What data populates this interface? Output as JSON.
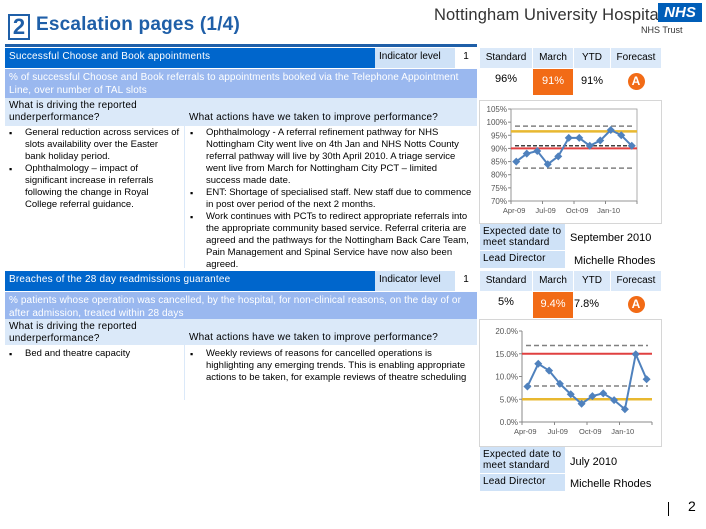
{
  "header": {
    "page_number_box": "2",
    "title": "Escalation pages (1/4)",
    "org_name": "Nottingham University Hospitals",
    "nhs_logo": "NHS",
    "trust_label": "NHS Trust"
  },
  "kpi_headers": {
    "standard": "Standard",
    "month": "March",
    "ytd": "YTD",
    "forecast": "Forecast"
  },
  "indicators": [
    {
      "name": "Successful Choose and Book appointments",
      "indicator_level_label": "Indicator level",
      "indicator_level": "1",
      "description": "% of successful Choose and Book referrals to appointments booked via the Telephone Appointment Line, over number of TAL slots",
      "standard": "96%",
      "month_value": "91%",
      "ytd": "91%",
      "forecast": "A",
      "driving_heading": "What is driving the reported underperformance?",
      "driving_items": [
        "General reduction across services of slots availability over the Easter bank holiday period.",
        "Ophthalmology – impact of significant increase in referrals following the change in Royal College referral guidance."
      ],
      "actions_heading": "What actions have we taken to improve performance?",
      "actions_items": [
        "Ophthalmology - A referral refinement pathway for NHS Nottingham City went live on 4th Jan and NHS Notts County referral pathway will live by 30th April 2010.  A triage service went  live from March for Nottingham City PCT – limited success made date.",
        "ENT: Shortage of specialised staff. New staff due to commence in post over period of the next 2 months.",
        "Work continues with PCTs to redirect appropriate referrals into the appropriate community based service.  Referral criteria are agreed and the pathways for the Nottingham Back Care Team, Pain Management and Spinal Service have now also been agreed."
      ],
      "expected_date_label": "Expected date to meet standard",
      "expected_date": "September 2010",
      "lead_director_label": "Lead Director",
      "lead_director": "Michelle Rhodes"
    },
    {
      "name": "Breaches of the 28 day readmissions guarantee",
      "indicator_level_label": "Indicator level",
      "indicator_level": "1",
      "description": "% patients whose operation was cancelled, by the hospital, for non-clinical reasons, on the day of or after admission, treated within 28 days",
      "standard": "5%",
      "month_value": "9.4%",
      "ytd": "7.8%",
      "forecast": "A",
      "driving_heading": "What is driving the reported underperformance?",
      "driving_items": [
        "Bed and theatre capacity"
      ],
      "actions_heading": "What actions have we taken to improve performance?",
      "actions_items": [
        "Weekly reviews of reasons for cancelled operations is highlighting any emerging trends. This is enabling appropriate actions to be taken, for example reviews of theatre scheduling"
      ],
      "expected_date_label": "Expected date to meet standard",
      "expected_date": "July 2010",
      "lead_director_label": "Lead Director",
      "lead_director": "Michelle Rhodes"
    }
  ],
  "colors": {
    "header_blue": "#0066cc",
    "title_blue": "#1f5fa8",
    "desc_blue": "#9ab8ef",
    "light_blue": "#dbe9f9",
    "amber": "#f26b16",
    "series": "#4f81bd",
    "target_red": "#e04040",
    "target_yellow": "#e8b830"
  },
  "footer": {
    "page": "2"
  },
  "chart_data": [
    {
      "type": "line",
      "title": "",
      "x": [
        "Apr-09",
        "May-09",
        "Jun-09",
        "Jul-09",
        "Aug-09",
        "Sep-09",
        "Oct-09",
        "Nov-09",
        "Dec-09",
        "Jan-10",
        "Feb-10",
        "Mar-10"
      ],
      "x_tick_labels": [
        "Apr-09",
        "Jul-09",
        "Oct-09",
        "Jan-10"
      ],
      "series": [
        {
          "name": "Actual",
          "values": [
            85,
            88,
            89,
            84,
            87,
            94,
            94,
            91,
            93,
            97,
            95,
            91
          ]
        }
      ],
      "reference_lines": [
        {
          "name": "Upper control limit",
          "value": 98.5,
          "style": "dashed-grey"
        },
        {
          "name": "Standard",
          "value": 96.5,
          "style": "solid-yellow"
        },
        {
          "name": "Mean",
          "value": 91,
          "style": "dashed-black"
        },
        {
          "name": "Threshold",
          "value": 90,
          "style": "solid-red"
        },
        {
          "name": "Lower control limit",
          "value": 82.5,
          "style": "dashed-grey"
        }
      ],
      "y_ticks": [
        "70%",
        "75%",
        "80%",
        "85%",
        "90%",
        "95%",
        "100%",
        "105%"
      ],
      "ylim": [
        70,
        105
      ],
      "xlabel": "",
      "ylabel": "",
      "grid": false,
      "legend": "none"
    },
    {
      "type": "line",
      "title": "",
      "x": [
        "Apr-09",
        "May-09",
        "Jun-09",
        "Jul-09",
        "Aug-09",
        "Sep-09",
        "Oct-09",
        "Nov-09",
        "Dec-09",
        "Jan-10",
        "Feb-10",
        "Mar-10"
      ],
      "x_tick_labels": [
        "Apr-09",
        "Jul-09",
        "Oct-09",
        "Jan-10"
      ],
      "series": [
        {
          "name": "Actual",
          "values": [
            7.8,
            12.8,
            11.3,
            8.4,
            6.1,
            4.0,
            5.7,
            6.3,
            4.8,
            2.8,
            14.9,
            9.4
          ]
        }
      ],
      "reference_lines": [
        {
          "name": "Upper control limit",
          "value": 16.8,
          "style": "dashed-grey"
        },
        {
          "name": "Threshold",
          "value": 15,
          "style": "solid-red"
        },
        {
          "name": "Mean",
          "value": 7.9,
          "style": "dashed-grey"
        },
        {
          "name": "Standard",
          "value": 5,
          "style": "solid-yellow"
        }
      ],
      "y_ticks": [
        "0.0%",
        "5.0%",
        "10.0%",
        "15.0%",
        "20.0%"
      ],
      "ylim": [
        0,
        20
      ],
      "xlabel": "",
      "ylabel": "",
      "grid": false,
      "legend": "none"
    }
  ]
}
